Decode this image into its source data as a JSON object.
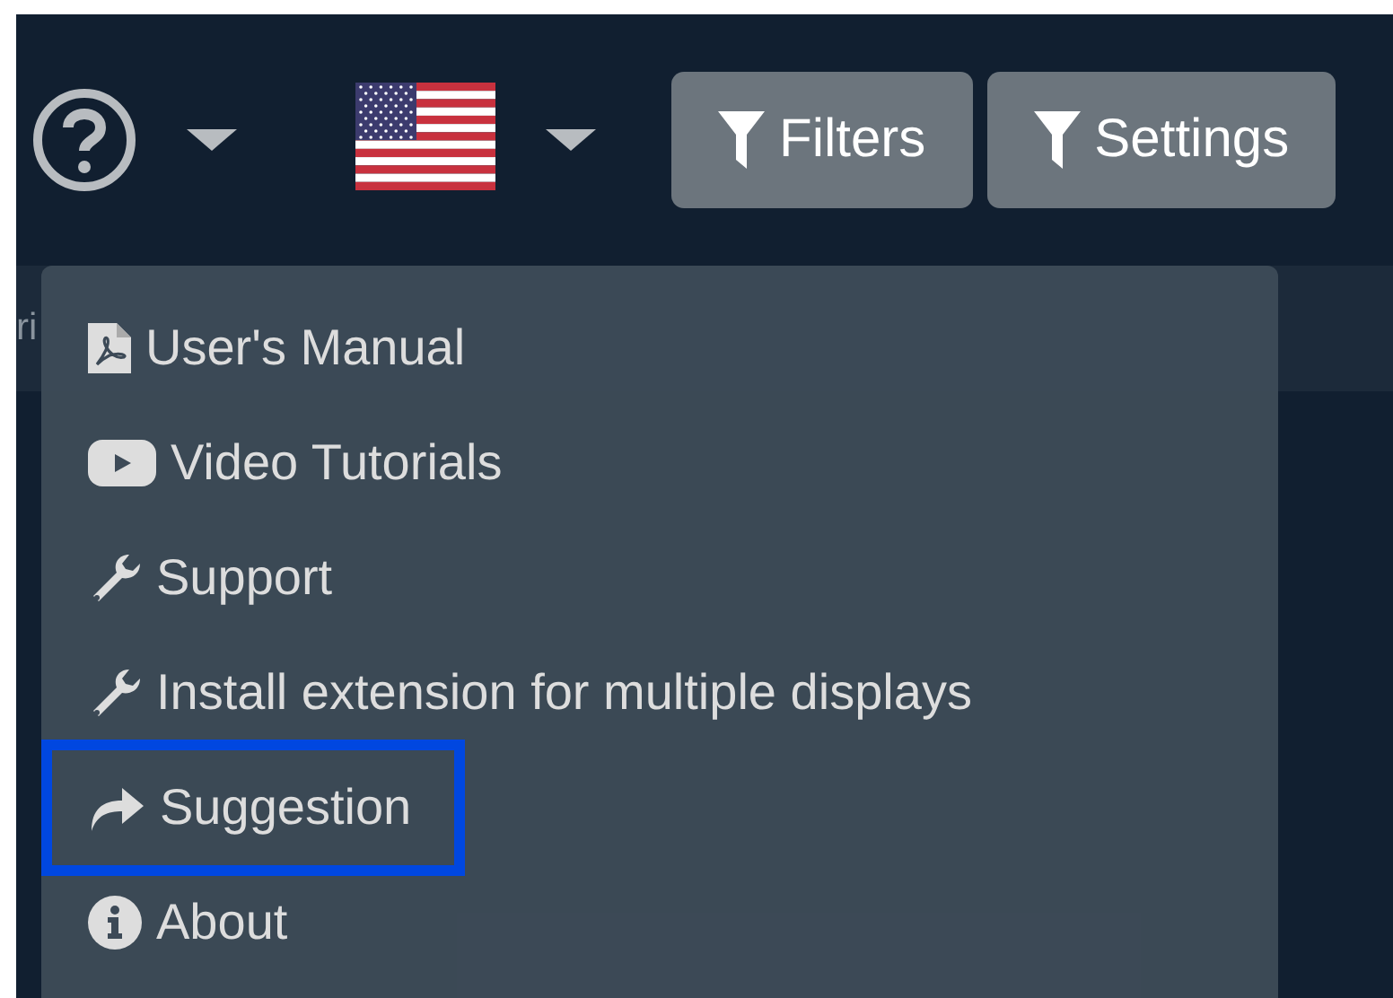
{
  "toolbar": {
    "buttons": [
      {
        "label": "Filters"
      },
      {
        "label": "Settings"
      }
    ]
  },
  "background_table": {
    "column_header": "ri"
  },
  "help_menu": {
    "items": [
      {
        "kind": "pdf",
        "label": "User's Manual",
        "highlighted": false
      },
      {
        "kind": "video",
        "label": "Video Tutorials",
        "highlighted": false
      },
      {
        "kind": "wrench",
        "label": "Support",
        "highlighted": false
      },
      {
        "kind": "wrench",
        "label": "Install extension for multiple displays",
        "highlighted": false
      },
      {
        "kind": "share",
        "label": "Suggestion",
        "highlighted": true
      },
      {
        "kind": "info",
        "label": "About",
        "highlighted": false
      }
    ]
  }
}
